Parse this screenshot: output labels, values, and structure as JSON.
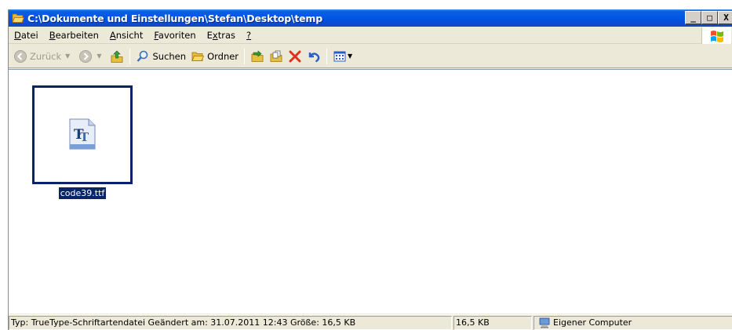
{
  "window": {
    "title": "C:\\Dokumente und Einstellungen\\Stefan\\Desktop\\temp",
    "buttons": {
      "minimize": "_",
      "maximize": "□",
      "close": "X"
    }
  },
  "menu": {
    "items": [
      {
        "pre": "",
        "u": "D",
        "post": "atei"
      },
      {
        "pre": "",
        "u": "B",
        "post": "earbeiten"
      },
      {
        "pre": "",
        "u": "A",
        "post": "nsicht"
      },
      {
        "pre": "",
        "u": "F",
        "post": "avoriten"
      },
      {
        "pre": "E",
        "u": "x",
        "post": "tras"
      },
      {
        "pre": "",
        "u": "?",
        "post": ""
      }
    ]
  },
  "toolbar": {
    "back_label": "Zurück",
    "search_label": "Suchen",
    "folders_label": "Ordner"
  },
  "files": [
    {
      "name": "code39.ttf",
      "icon": "truetype-font-icon",
      "selected": true
    }
  ],
  "status": {
    "info": "Typ: TrueType-Schriftartendatei Geändert am: 31.07.2011 12:43 Größe: 16,5 KB",
    "size": "16,5 KB",
    "zone": "Eigener Computer"
  },
  "colors": {
    "titlebar": "#0054e3",
    "selection": "#0a246a",
    "chrome": "#ece9d8"
  }
}
